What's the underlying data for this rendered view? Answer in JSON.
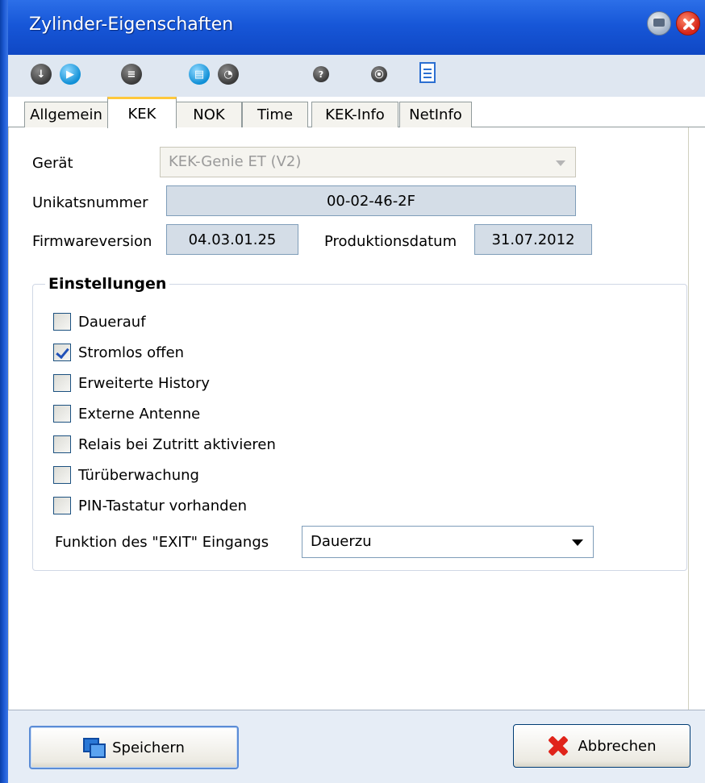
{
  "window": {
    "title": "Zylinder-Eigenschaften"
  },
  "toolbar": {
    "icons": [
      "download-icon",
      "play-icon",
      "list-icon",
      "memory-icon",
      "clock-icon",
      "help-icon",
      "radio-icon",
      "document-icon"
    ]
  },
  "tabs": [
    {
      "label": "Allgemein",
      "active": false
    },
    {
      "label": "KEK",
      "active": true
    },
    {
      "label": "NOK",
      "active": false
    },
    {
      "label": "Time",
      "active": false
    },
    {
      "label": "KEK-Info",
      "active": false
    },
    {
      "label": "NetInfo",
      "active": false
    }
  ],
  "kek": {
    "device_label": "Gerät",
    "device_value": "KEK-Genie ET (V2)",
    "serial_label": "Unikatsnummer",
    "serial_value": "00-02-46-2F",
    "firmware_label": "Firmwareversion",
    "firmware_value": "04.03.01.25",
    "production_label": "Produktionsdatum",
    "production_value": "31.07.2012"
  },
  "settings": {
    "title": "Einstellungen",
    "options": [
      {
        "label": "Dauerauf",
        "checked": false
      },
      {
        "label": "Stromlos offen",
        "checked": true
      },
      {
        "label": "Erweiterte History",
        "checked": false
      },
      {
        "label": "Externe Antenne",
        "checked": false
      },
      {
        "label": "Relais bei Zutritt aktivieren",
        "checked": false
      },
      {
        "label": "Türüberwachung",
        "checked": false
      },
      {
        "label": "PIN-Tastatur vorhanden",
        "checked": false
      }
    ],
    "exit_label": "Funktion des \"EXIT\" Eingangs",
    "exit_value": "Dauerzu"
  },
  "buttons": {
    "save": "Speichern",
    "cancel": "Abbrechen"
  },
  "colors": {
    "title_bar": "#1757d8",
    "accent_tab": "#ffc83c",
    "close": "#d6261a"
  }
}
